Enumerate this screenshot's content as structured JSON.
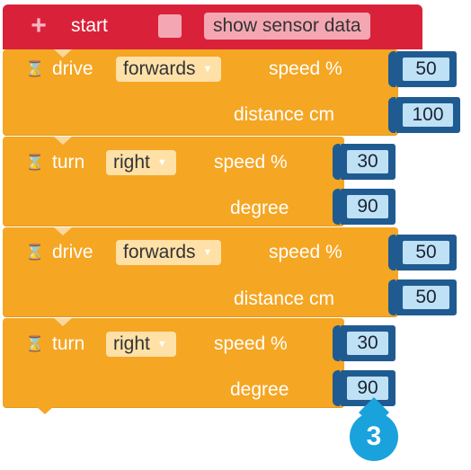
{
  "start_block": {
    "plus_glyph": "+",
    "label": "start",
    "checkbox_checked": false,
    "sensor_label": "show sensor data"
  },
  "blocks": [
    {
      "type": "drive",
      "label": "drive",
      "dropdown": "forwards",
      "param1_label": "speed %",
      "param1_value": "50",
      "param2_label": "distance cm",
      "param2_value": "100"
    },
    {
      "type": "turn",
      "label": "turn",
      "dropdown": "right",
      "param1_label": "speed %",
      "param1_value": "30",
      "param2_label": "degree",
      "param2_value": "90"
    },
    {
      "type": "drive",
      "label": "drive",
      "dropdown": "forwards",
      "param1_label": "speed %",
      "param1_value": "50",
      "param2_label": "distance cm",
      "param2_value": "50"
    },
    {
      "type": "turn",
      "label": "turn",
      "dropdown": "right",
      "param1_label": "speed %",
      "param1_value": "30",
      "param2_label": "degree",
      "param2_value": "90"
    }
  ],
  "icons": {
    "hourglass": "⌛",
    "dropdown_chevron": "▼"
  },
  "badge": {
    "number": "3"
  },
  "colors": {
    "start_red": "#d9223a",
    "block_orange": "#f5a623",
    "number_blue": "#1f5b91",
    "number_field": "#bfe1f5",
    "badge_blue": "#1aa2dc"
  }
}
